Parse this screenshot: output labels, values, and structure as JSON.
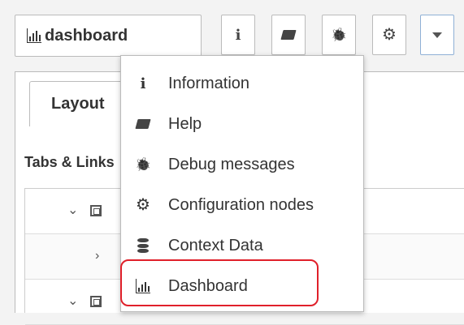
{
  "header": {
    "tab_label": "dashboard",
    "buttons": [
      {
        "icon": "info-icon",
        "glyph": "i"
      },
      {
        "icon": "book-icon"
      },
      {
        "icon": "bug-icon",
        "glyph": "🐞"
      },
      {
        "icon": "gear-icon",
        "glyph": "⚙"
      },
      {
        "icon": "chevron-down-icon"
      }
    ]
  },
  "panel": {
    "tab_label": "Layout",
    "section_title": "Tabs & Links"
  },
  "menu": {
    "items": [
      {
        "label": "Information",
        "icon": "info-icon"
      },
      {
        "label": "Help",
        "icon": "book-icon"
      },
      {
        "label": "Debug messages",
        "icon": "bug-icon"
      },
      {
        "label": "Configuration nodes",
        "icon": "gear-icon"
      },
      {
        "label": "Context Data",
        "icon": "database-icon"
      },
      {
        "label": "Dashboard",
        "icon": "chart-icon"
      }
    ]
  },
  "colors": {
    "highlight": "#e0202a",
    "active_border": "#8fb0d6"
  }
}
